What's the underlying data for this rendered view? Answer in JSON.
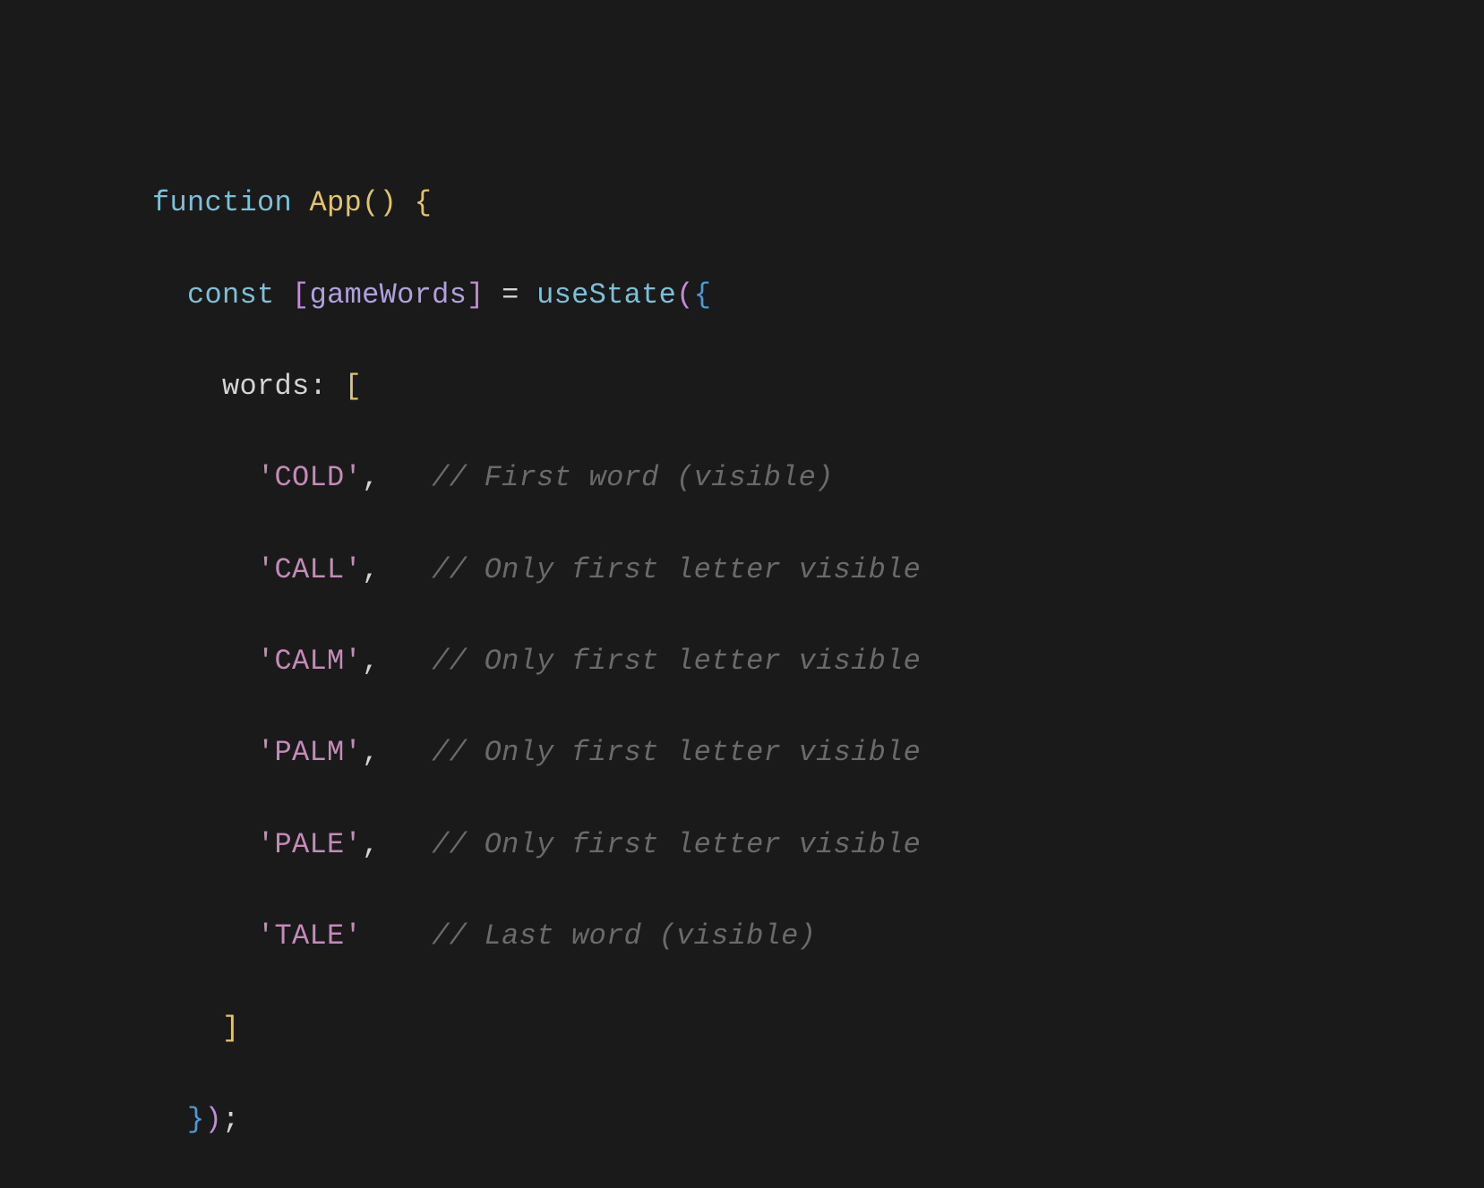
{
  "code": {
    "line1": {
      "function_kw": "function",
      "fn_name": "App",
      "parens": "()",
      "brace_open": "{"
    },
    "line2": {
      "const_kw": "const",
      "bracket_open": "[",
      "var_name": "gameWords",
      "bracket_close": "]",
      "equals": "=",
      "fn_call": "useState",
      "paren_open": "(",
      "brace_open": "{"
    },
    "line3": {
      "prop_name": "words",
      "colon": ":",
      "bracket_open": "["
    },
    "words": [
      {
        "value": "'COLD'",
        "comma": ",",
        "comment": "// First word (visible)"
      },
      {
        "value": "'CALL'",
        "comma": ",",
        "comment": "// Only first letter visible"
      },
      {
        "value": "'CALM'",
        "comma": ",",
        "comment": "// Only first letter visible"
      },
      {
        "value": "'PALM'",
        "comma": ",",
        "comment": "// Only first letter visible"
      },
      {
        "value": "'PALE'",
        "comma": ",",
        "comment": "// Only first letter visible"
      },
      {
        "value": "'TALE'",
        "comma": "",
        "comment": "// Last word (visible)"
      }
    ],
    "line_close_array": {
      "bracket_close": "]"
    },
    "line_close_call": {
      "brace_close": "}",
      "paren_close": ")",
      "semicolon": ";"
    }
  }
}
